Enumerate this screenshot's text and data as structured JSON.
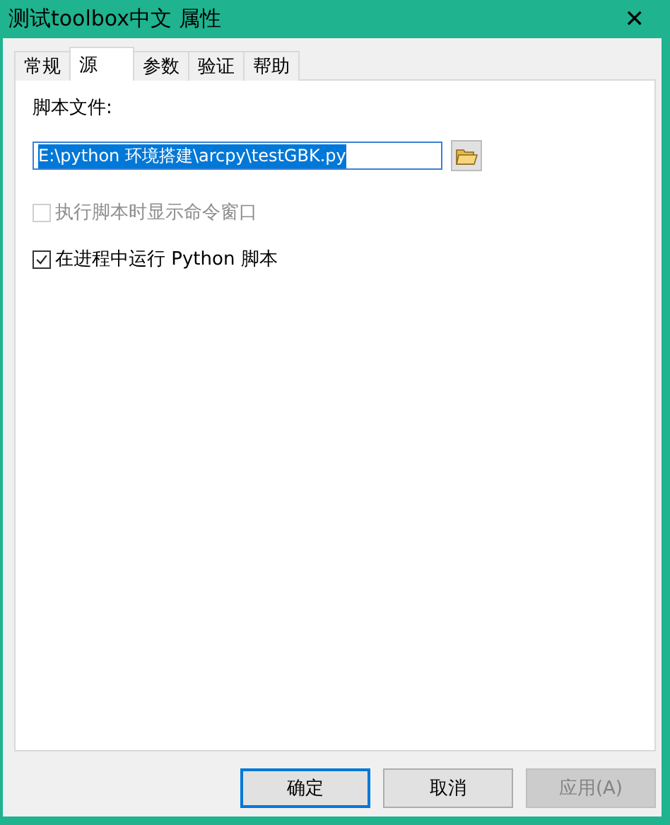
{
  "window": {
    "title": "测试toolbox中文 属性",
    "close": "✕"
  },
  "tabs": [
    {
      "label": "常规",
      "selected": false
    },
    {
      "label": "源",
      "selected": true
    },
    {
      "label": "参数",
      "selected": false
    },
    {
      "label": "验证",
      "selected": false
    },
    {
      "label": "帮助",
      "selected": false
    }
  ],
  "script_file": {
    "label": "脚本文件:",
    "value": "E:\\python 环境搭建\\arcpy\\testGBK.py",
    "text_selected": true
  },
  "options": [
    {
      "label": "执行脚本时显示命令窗口",
      "checked": false,
      "disabled": true
    },
    {
      "label": "在进程中运行 Python 脚本",
      "checked": true,
      "disabled": false
    }
  ],
  "buttons": [
    {
      "label": "确定",
      "default": true,
      "disabled": false
    },
    {
      "label": "取消",
      "default": false,
      "disabled": false
    },
    {
      "label": "应用(A)",
      "default": false,
      "disabled": true
    }
  ]
}
